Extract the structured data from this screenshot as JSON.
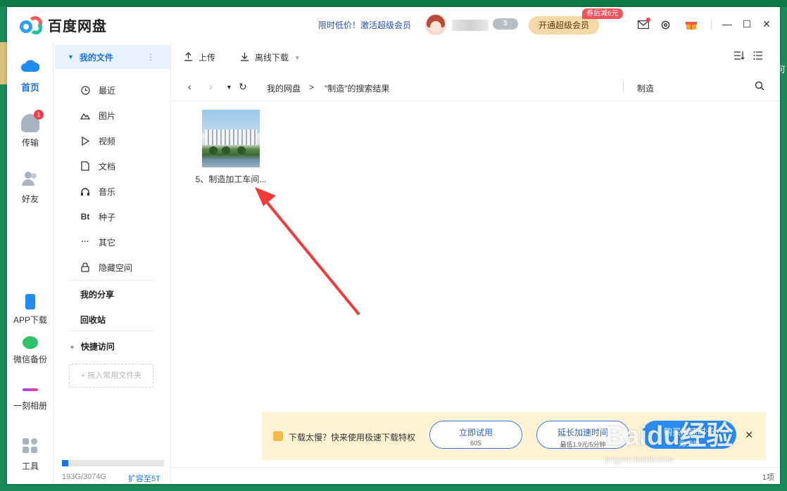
{
  "app": {
    "name": "百度网盘"
  },
  "header": {
    "promo_prefix": "限时低价！",
    "promo_link": "激活超级会员",
    "coin_label": "$",
    "vip_button": "开通超级会员",
    "vip_tag": "券后减6元"
  },
  "leftnav": {
    "items": [
      {
        "label": "首页"
      },
      {
        "label": "传输",
        "badge": "1"
      },
      {
        "label": "好友"
      },
      {
        "label": "APP下载"
      },
      {
        "label": "微信备份"
      },
      {
        "label": "一刻相册"
      },
      {
        "label": "工具"
      }
    ]
  },
  "sidebar": {
    "my_files": "我的文件",
    "items": [
      {
        "label": "最近"
      },
      {
        "label": "图片"
      },
      {
        "label": "视频"
      },
      {
        "label": "文档"
      },
      {
        "label": "音乐"
      },
      {
        "label": "种子",
        "icon_text": "Bt"
      },
      {
        "label": "其它"
      },
      {
        "label": "隐藏空间"
      }
    ],
    "my_share": "我的分享",
    "recycle": "回收站",
    "quick_access": "快捷访问",
    "drop_hint": "+ 拖入常用文件夹",
    "storage_text": "193G/3074G",
    "storage_used_fraction": 0.063,
    "expand_link": "扩容至5T"
  },
  "toolbar": {
    "upload": "上传",
    "offline_download": "离线下载"
  },
  "pathbar": {
    "root": "我的网盘",
    "separator": ">",
    "current": "\"制造\"的搜索结果",
    "search_value": "制造"
  },
  "files": [
    {
      "name": "5、制造加工车间..."
    }
  ],
  "status": {
    "count": "1项"
  },
  "promo": {
    "text": "下载太慢？快来使用极速下载特权",
    "btn1_title": "立即试用",
    "btn1_sub": "60S",
    "btn2_title": "延长加速时间",
    "btn2_sub": "最低1.9元/5分钟",
    "btn3_title": "购买加速时长",
    "btn3_sub": "元/分钟"
  },
  "watermark": {
    "logo": "Baidu经验",
    "url": "jingyan.baidu.com"
  },
  "desktop": {
    "right_text": "可"
  },
  "colors": {
    "accent": "#1a73e8",
    "vip": "#f5d9a6",
    "promo_bg": "#fdf3d3",
    "arrow": "#f23a3a"
  }
}
